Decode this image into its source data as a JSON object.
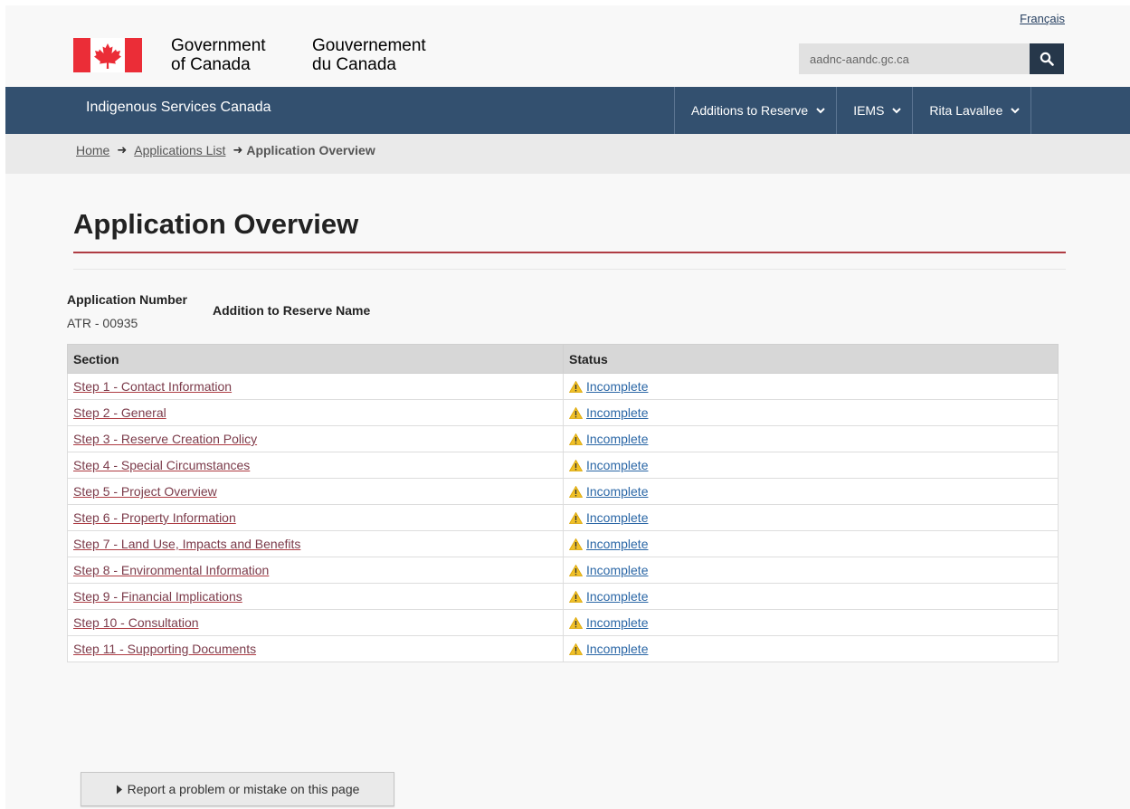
{
  "header": {
    "language_link": "Français",
    "signature_en_line1": "Government",
    "signature_en_line2": "of Canada",
    "signature_fr_line1": "Gouvernement",
    "signature_fr_line2": "du Canada",
    "search_placeholder": "aadnc-aandc.gc.ca",
    "brand_red": "#eb2d37"
  },
  "nav": {
    "site_title": "Indigenous Services Canada",
    "menu": [
      {
        "label": "Additions to Reserve"
      },
      {
        "label": "IEMS"
      },
      {
        "label": "Rita Lavallee"
      }
    ],
    "bar_color": "#33506f"
  },
  "breadcrumb": {
    "items": [
      "Home",
      "Applications List"
    ],
    "current": "Application Overview"
  },
  "page": {
    "title": "Application Overview",
    "application_number_label": "Application Number",
    "application_number_value": "ATR - 00935",
    "atr_name_label": "Addition to Reserve Name"
  },
  "table": {
    "headers": [
      "Section",
      "Status"
    ],
    "rows": [
      {
        "section": "Step 1 - Contact Information",
        "status": "Incomplete"
      },
      {
        "section": "Step 2 - General",
        "status": "Incomplete"
      },
      {
        "section": "Step 3 - Reserve Creation Policy",
        "status": "Incomplete"
      },
      {
        "section": "Step 4 - Special Circumstances",
        "status": "Incomplete"
      },
      {
        "section": "Step 5 - Project Overview",
        "status": "Incomplete"
      },
      {
        "section": "Step 6 - Property Information",
        "status": "Incomplete"
      },
      {
        "section": "Step 7 - Land Use, Impacts and Benefits",
        "status": "Incomplete"
      },
      {
        "section": "Step 8 - Environmental Information",
        "status": "Incomplete"
      },
      {
        "section": "Step 9 - Financial Implications",
        "status": "Incomplete"
      },
      {
        "section": "Step 10 - Consultation",
        "status": "Incomplete"
      },
      {
        "section": "Step 11 - Supporting Documents",
        "status": "Incomplete"
      }
    ]
  },
  "footer": {
    "report_button": "Report a problem or mistake on this page"
  }
}
